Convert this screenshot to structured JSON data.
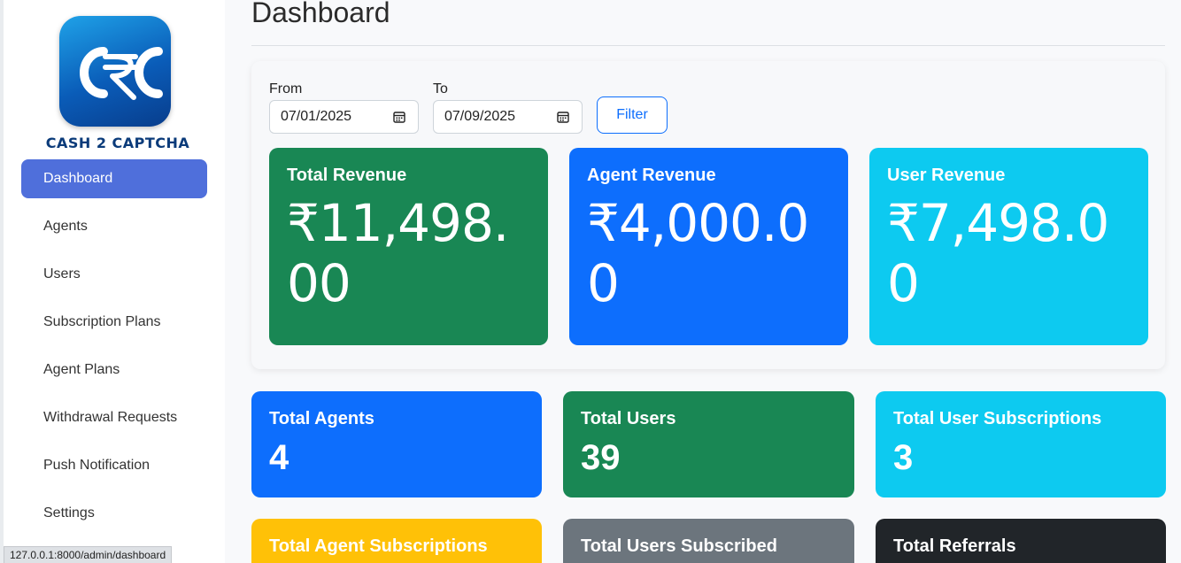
{
  "brand": {
    "name": "CASH 2 CAPTCHA",
    "logo_colors": [
      "#1fa2e8",
      "#0a5cb8"
    ]
  },
  "sidebar": {
    "items": [
      {
        "label": "Dashboard",
        "active": true
      },
      {
        "label": "Agents"
      },
      {
        "label": "Users"
      },
      {
        "label": "Subscription Plans"
      },
      {
        "label": "Agent Plans"
      },
      {
        "label": "Withdrawal Requests"
      },
      {
        "label": "Push Notification"
      },
      {
        "label": "Settings"
      }
    ]
  },
  "status_bar": {
    "url": "127.0.0.1:8000/admin/dashboard"
  },
  "page": {
    "title": "Dashboard"
  },
  "filter": {
    "from_label": "From",
    "from_value": "07/01/2025",
    "to_label": "To",
    "to_value": "07/09/2025",
    "button_label": "Filter"
  },
  "revenue": [
    {
      "label": "Total Revenue",
      "value": "₹11,498.00",
      "color": "#198754"
    },
    {
      "label": "Agent Revenue",
      "value": "₹4,000.00",
      "color": "#0d6efd"
    },
    {
      "label": "User Revenue",
      "value": "₹7,498.00",
      "color": "#0dcaf0"
    }
  ],
  "stats": [
    {
      "label": "Total Agents",
      "value": "4",
      "color": "#0d6efd"
    },
    {
      "label": "Total Users",
      "value": "39",
      "color": "#198754"
    },
    {
      "label": "Total User Subscriptions",
      "value": "3",
      "color": "#0dcaf0"
    },
    {
      "label": "Total Agent Subscriptions",
      "value": "",
      "color": "#ffc107"
    },
    {
      "label": "Total Users Subscribed",
      "value": "",
      "color": "#6c757d"
    },
    {
      "label": "Total Referrals",
      "value": "",
      "color": "#212529"
    }
  ]
}
